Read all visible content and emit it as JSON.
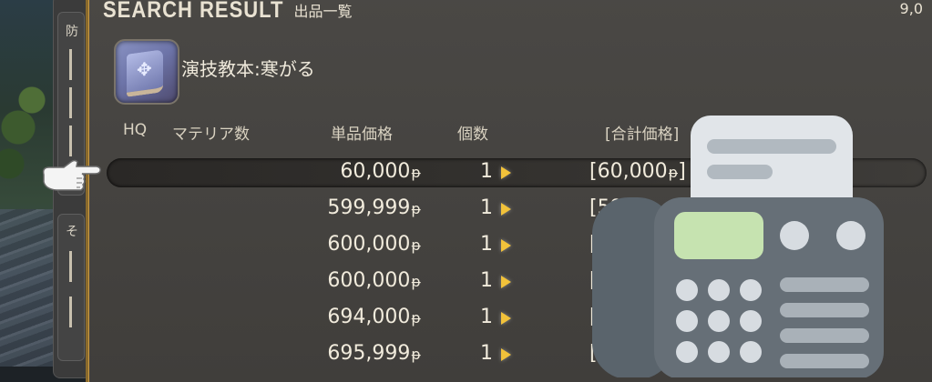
{
  "window": {
    "title_en": "SEARCH RESULT",
    "title_jp": "出品一覧",
    "top_right": "9,0"
  },
  "category_panel": {
    "top_label": "防",
    "bottom_label": "そ"
  },
  "item": {
    "name": "演技教本:寒がる",
    "icon": "book-icon"
  },
  "columns": {
    "hq": "HQ",
    "materia": "マテリア数",
    "unit_price": "単品価格",
    "quantity": "個数",
    "total_price": "[合計価格]"
  },
  "listings": [
    {
      "price": "60,000",
      "qty": "1",
      "total": "[60,000",
      "selected": true
    },
    {
      "price": "599,999",
      "qty": "1",
      "total": "[59",
      "selected": false
    },
    {
      "price": "600,000",
      "qty": "1",
      "total": "[6",
      "selected": false
    },
    {
      "price": "600,000",
      "qty": "1",
      "total": "[6",
      "selected": false
    },
    {
      "price": "694,000",
      "qty": "1",
      "total": "[6",
      "selected": false
    },
    {
      "price": "695,999",
      "qty": "1",
      "total": "[6",
      "selected": false
    }
  ],
  "gil_symbol": "ᵽ",
  "overlay": {
    "icon": "fax-machine-icon"
  }
}
